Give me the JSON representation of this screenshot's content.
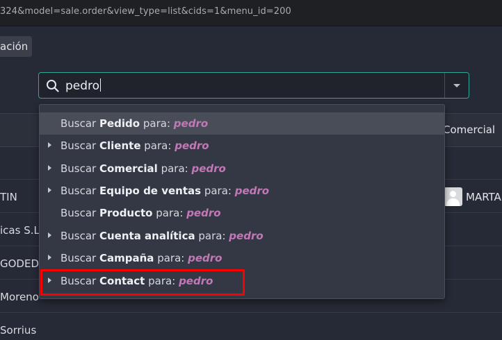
{
  "browser": {
    "url": "324&model=sale.order&view_type=list&cids=1&menu_id=200"
  },
  "breadcrumb": {
    "label": "ación"
  },
  "search": {
    "value": "pedro"
  },
  "table": {
    "column_comercial": "Comercial",
    "rows": [
      {
        "name": "TIN",
        "user": "MARTA"
      },
      {
        "name": "icas S.L.,"
      },
      {
        "name": "GODED C"
      },
      {
        "name": " Moreno"
      },
      {
        "name": " Sorrius"
      }
    ]
  },
  "dropdown": {
    "prefix": "Buscar",
    "connector": "para:",
    "query": "pedro",
    "items": [
      {
        "field": "Pedido",
        "expandable": false,
        "active": true
      },
      {
        "field": "Cliente",
        "expandable": true,
        "active": false
      },
      {
        "field": "Comercial",
        "expandable": true,
        "active": false
      },
      {
        "field": "Equipo de ventas",
        "expandable": true,
        "active": false
      },
      {
        "field": "Producto",
        "expandable": false,
        "active": false
      },
      {
        "field": "Cuenta analítica",
        "expandable": true,
        "active": false
      },
      {
        "field": "Campaña",
        "expandable": true,
        "active": false
      },
      {
        "field": "Contact",
        "expandable": true,
        "active": false,
        "highlighted": true
      }
    ]
  },
  "colors": {
    "background": "#262a36",
    "search_border": "#2fa79a",
    "query_text": "#c277b6",
    "highlight_box": "#ff0000"
  },
  "icons": {
    "search": "search-icon",
    "dropdown_toggle": "caret-down-icon",
    "expand": "caret-right-icon",
    "avatar": "user-avatar-icon"
  }
}
